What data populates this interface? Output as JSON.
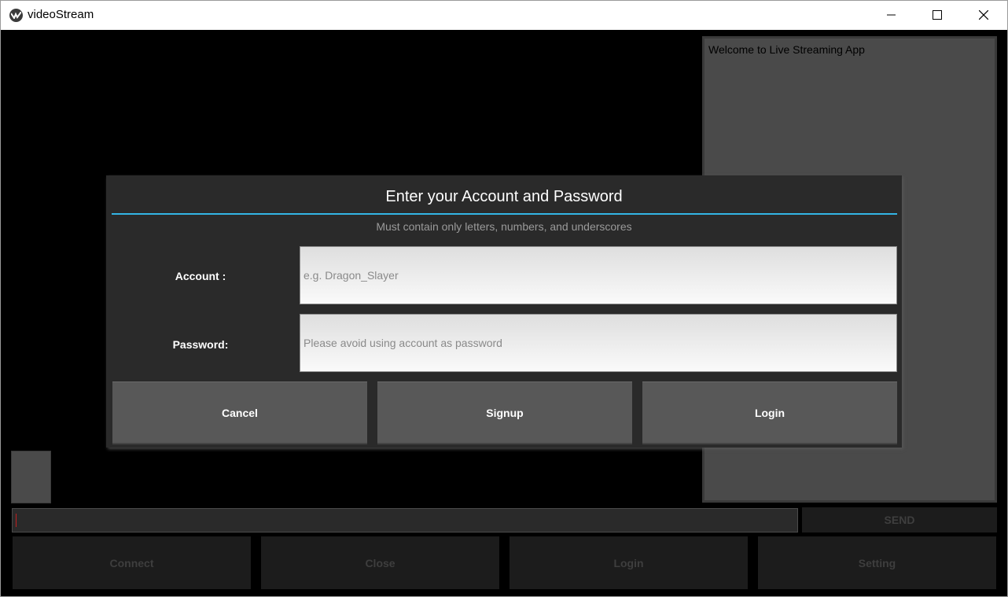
{
  "window": {
    "title": "videoStream"
  },
  "chat": {
    "welcome": "Welcome to Live Streaming App"
  },
  "message": {
    "value": "",
    "send_label": "SEND"
  },
  "bottom_buttons": [
    {
      "label": "Connect"
    },
    {
      "label": "Close"
    },
    {
      "label": "Login"
    },
    {
      "label": "Setting"
    }
  ],
  "dialog": {
    "title": "Enter your Account and Password",
    "hint": "Must contain only letters, numbers, and underscores",
    "account": {
      "label": "Account :",
      "value": "",
      "placeholder": "e.g. Dragon_Slayer"
    },
    "password": {
      "label": "Password:",
      "value": "",
      "placeholder": "Please avoid using account as password"
    },
    "buttons": [
      {
        "label": "Cancel"
      },
      {
        "label": "Signup"
      },
      {
        "label": "Login"
      }
    ],
    "accent_color": "#33b5e5"
  },
  "icons": {
    "app": "kivy-logo-icon",
    "minimize": "minimize-icon",
    "maximize": "maximize-icon",
    "close": "close-icon"
  }
}
